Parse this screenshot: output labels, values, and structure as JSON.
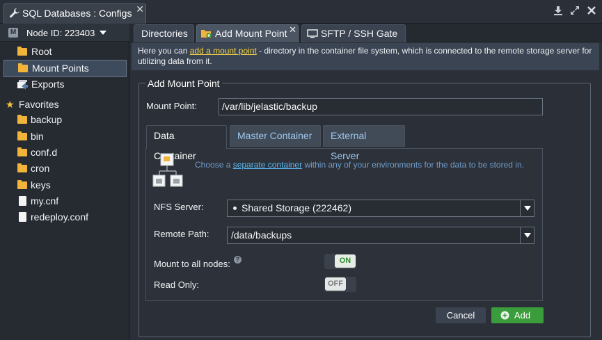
{
  "window": {
    "title": "SQL Databases : Configs"
  },
  "sidebar": {
    "node_label": "Node ID: 223403",
    "node_badge": "M",
    "items": [
      {
        "label": "Root",
        "icon": "folder-icon"
      },
      {
        "label": "Mount Points",
        "icon": "folder-icon",
        "selected": true
      },
      {
        "label": "Exports",
        "icon": "exports-icon"
      }
    ],
    "favorites_label": "Favorites",
    "favorites": [
      {
        "label": "backup",
        "icon": "folder-icon"
      },
      {
        "label": "bin",
        "icon": "folder-icon"
      },
      {
        "label": "conf.d",
        "icon": "folder-icon"
      },
      {
        "label": "cron",
        "icon": "folder-icon"
      },
      {
        "label": "keys",
        "icon": "folder-icon"
      },
      {
        "label": "my.cnf",
        "icon": "file-icon"
      },
      {
        "label": "redeploy.conf",
        "icon": "file-icon"
      }
    ]
  },
  "tabs": [
    {
      "label": "Directories"
    },
    {
      "label": "Add Mount Point",
      "active": true
    },
    {
      "label": "SFTP / SSH Gate"
    }
  ],
  "info": {
    "prefix": "Here you can ",
    "link": "add a mount point",
    "suffix": " - directory in the container file system, which is connected to the remote storage server for utilizing data from it."
  },
  "form": {
    "legend": "Add Mount Point",
    "mount_point_label": "Mount Point:",
    "mount_point_value": "/var/lib/jelastic/backup",
    "inner_tabs": [
      {
        "label": "Data Container",
        "active": true
      },
      {
        "label": "Master Container"
      },
      {
        "label": "External Server"
      }
    ],
    "hint_prefix": "Choose a ",
    "hint_link": "separate container",
    "hint_suffix": " within any of your environments for the data to be stored in.",
    "nfs_label": "NFS Server:",
    "nfs_value": "Shared Storage (222462)",
    "remote_label": "Remote Path:",
    "remote_value": "/data/backups",
    "mount_all_label": "Mount to all nodes:",
    "mount_all_state": "ON",
    "read_only_label": "Read Only:",
    "read_only_state": "OFF",
    "cancel_label": "Cancel",
    "add_label": "Add"
  },
  "colors": {
    "accent_green": "#3a9c3a",
    "link_yellow": "#f3d54b",
    "link_blue": "#5bb8f0",
    "folder": "#f2b33a"
  }
}
